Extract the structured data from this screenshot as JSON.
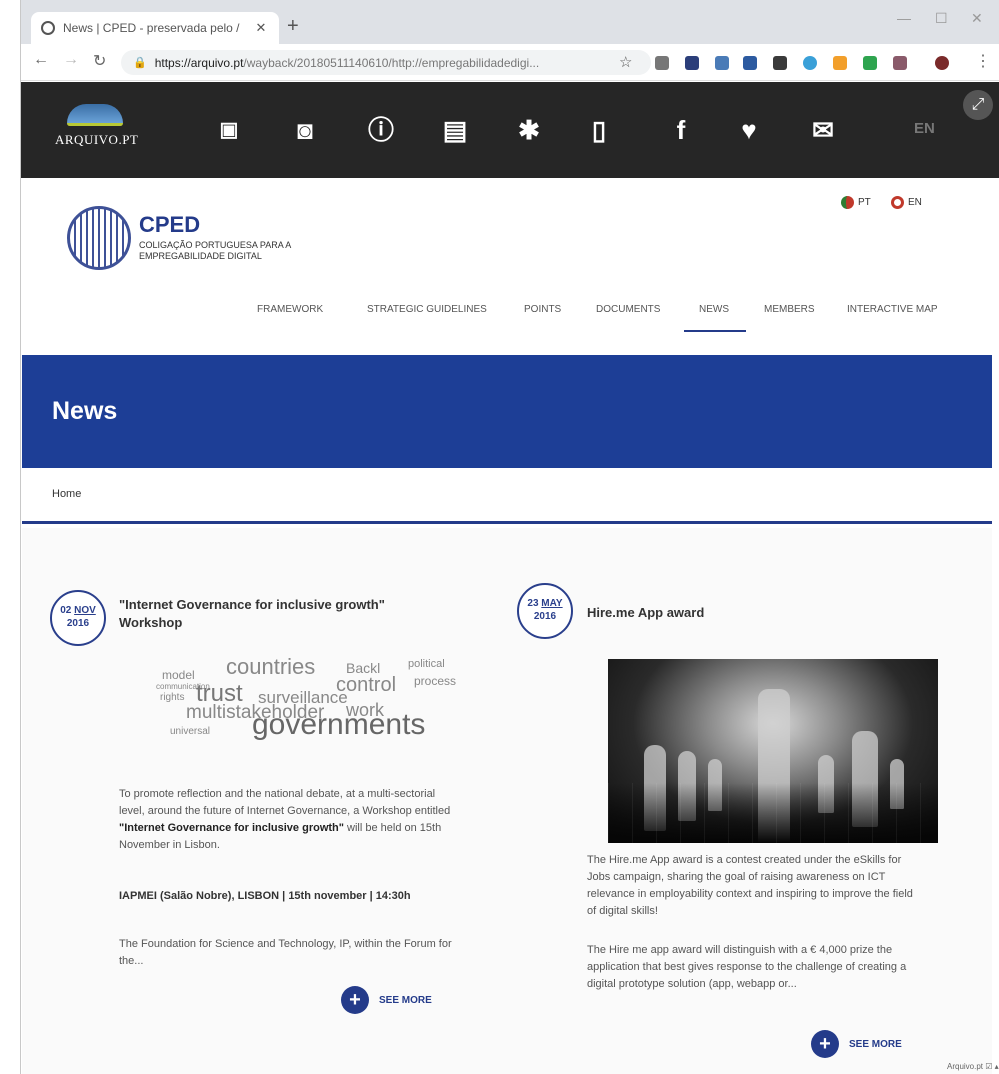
{
  "browser": {
    "tab_title": "News | CPED - preservada pelo /",
    "tab_close": "✕",
    "new_tab": "+",
    "url_host": "https://arquivo.pt",
    "url_path": "/wayback/20180511140610/http://empregabilidadedigi...",
    "win_min": "—",
    "win_max": "☐",
    "win_close": "✕"
  },
  "arquivo": {
    "logo_text": "ARQUIVO.PT",
    "lang": "EN"
  },
  "site": {
    "logo_title": "CPED",
    "logo_sub": "COLIGAÇÃO PORTUGUESA PARA A EMPREGABILIDADE DIGITAL",
    "lang_pt": "PT",
    "lang_en": "EN",
    "nav": [
      {
        "label": "FRAMEWORK"
      },
      {
        "label": "STRATEGIC GUIDELINES"
      },
      {
        "label": "POINTS"
      },
      {
        "label": "DOCUMENTS"
      },
      {
        "label": "NEWS"
      },
      {
        "label": "MEMBERS"
      },
      {
        "label": "INTERACTIVE MAP"
      }
    ],
    "hero_title": "News",
    "breadcrumb": "Home"
  },
  "news": [
    {
      "day": "02",
      "month": "NOV",
      "year": "2016",
      "title": "\"Internet Governance for inclusive growth\" Workshop",
      "text_a": "To promote reflection and the national debate, at a multi-sectorial level, around the future of Internet Governance, a Workshop entitled ",
      "text_b": "\"Internet Governance for inclusive growth\"",
      "text_c": " will be held on 15th November in Lisbon.",
      "venue": "IAPMEI (Salão Nobre), LISBON | 15th november | 14:30h",
      "text2": "The Foundation for Science and Technology, IP, within the Forum for the...",
      "see_more": "SEE MORE"
    },
    {
      "day": "23",
      "month": "MAY",
      "year": "2016",
      "title": "Hire.me App award",
      "text": "The Hire.me App award is a contest created under the eSkills for Jobs campaign, sharing the goal of raising awareness on ICT relevance in employability context and inspiring to improve the field of digital skills!",
      "text2": "The Hire me app award will distinguish with a € 4,000 prize the application that best gives response to the challenge of creating a digital prototype solution (app, webapp or...",
      "see_more": "SEE MORE"
    }
  ],
  "wordcloud": [
    "countries",
    "Backl",
    "political",
    "model",
    "communication",
    "control",
    "process",
    "rights",
    "trust",
    "surveillance",
    "multistakeholder",
    "work",
    "universal",
    "governments"
  ],
  "footer_tag": "Arquivo.pt ☑ ▴"
}
